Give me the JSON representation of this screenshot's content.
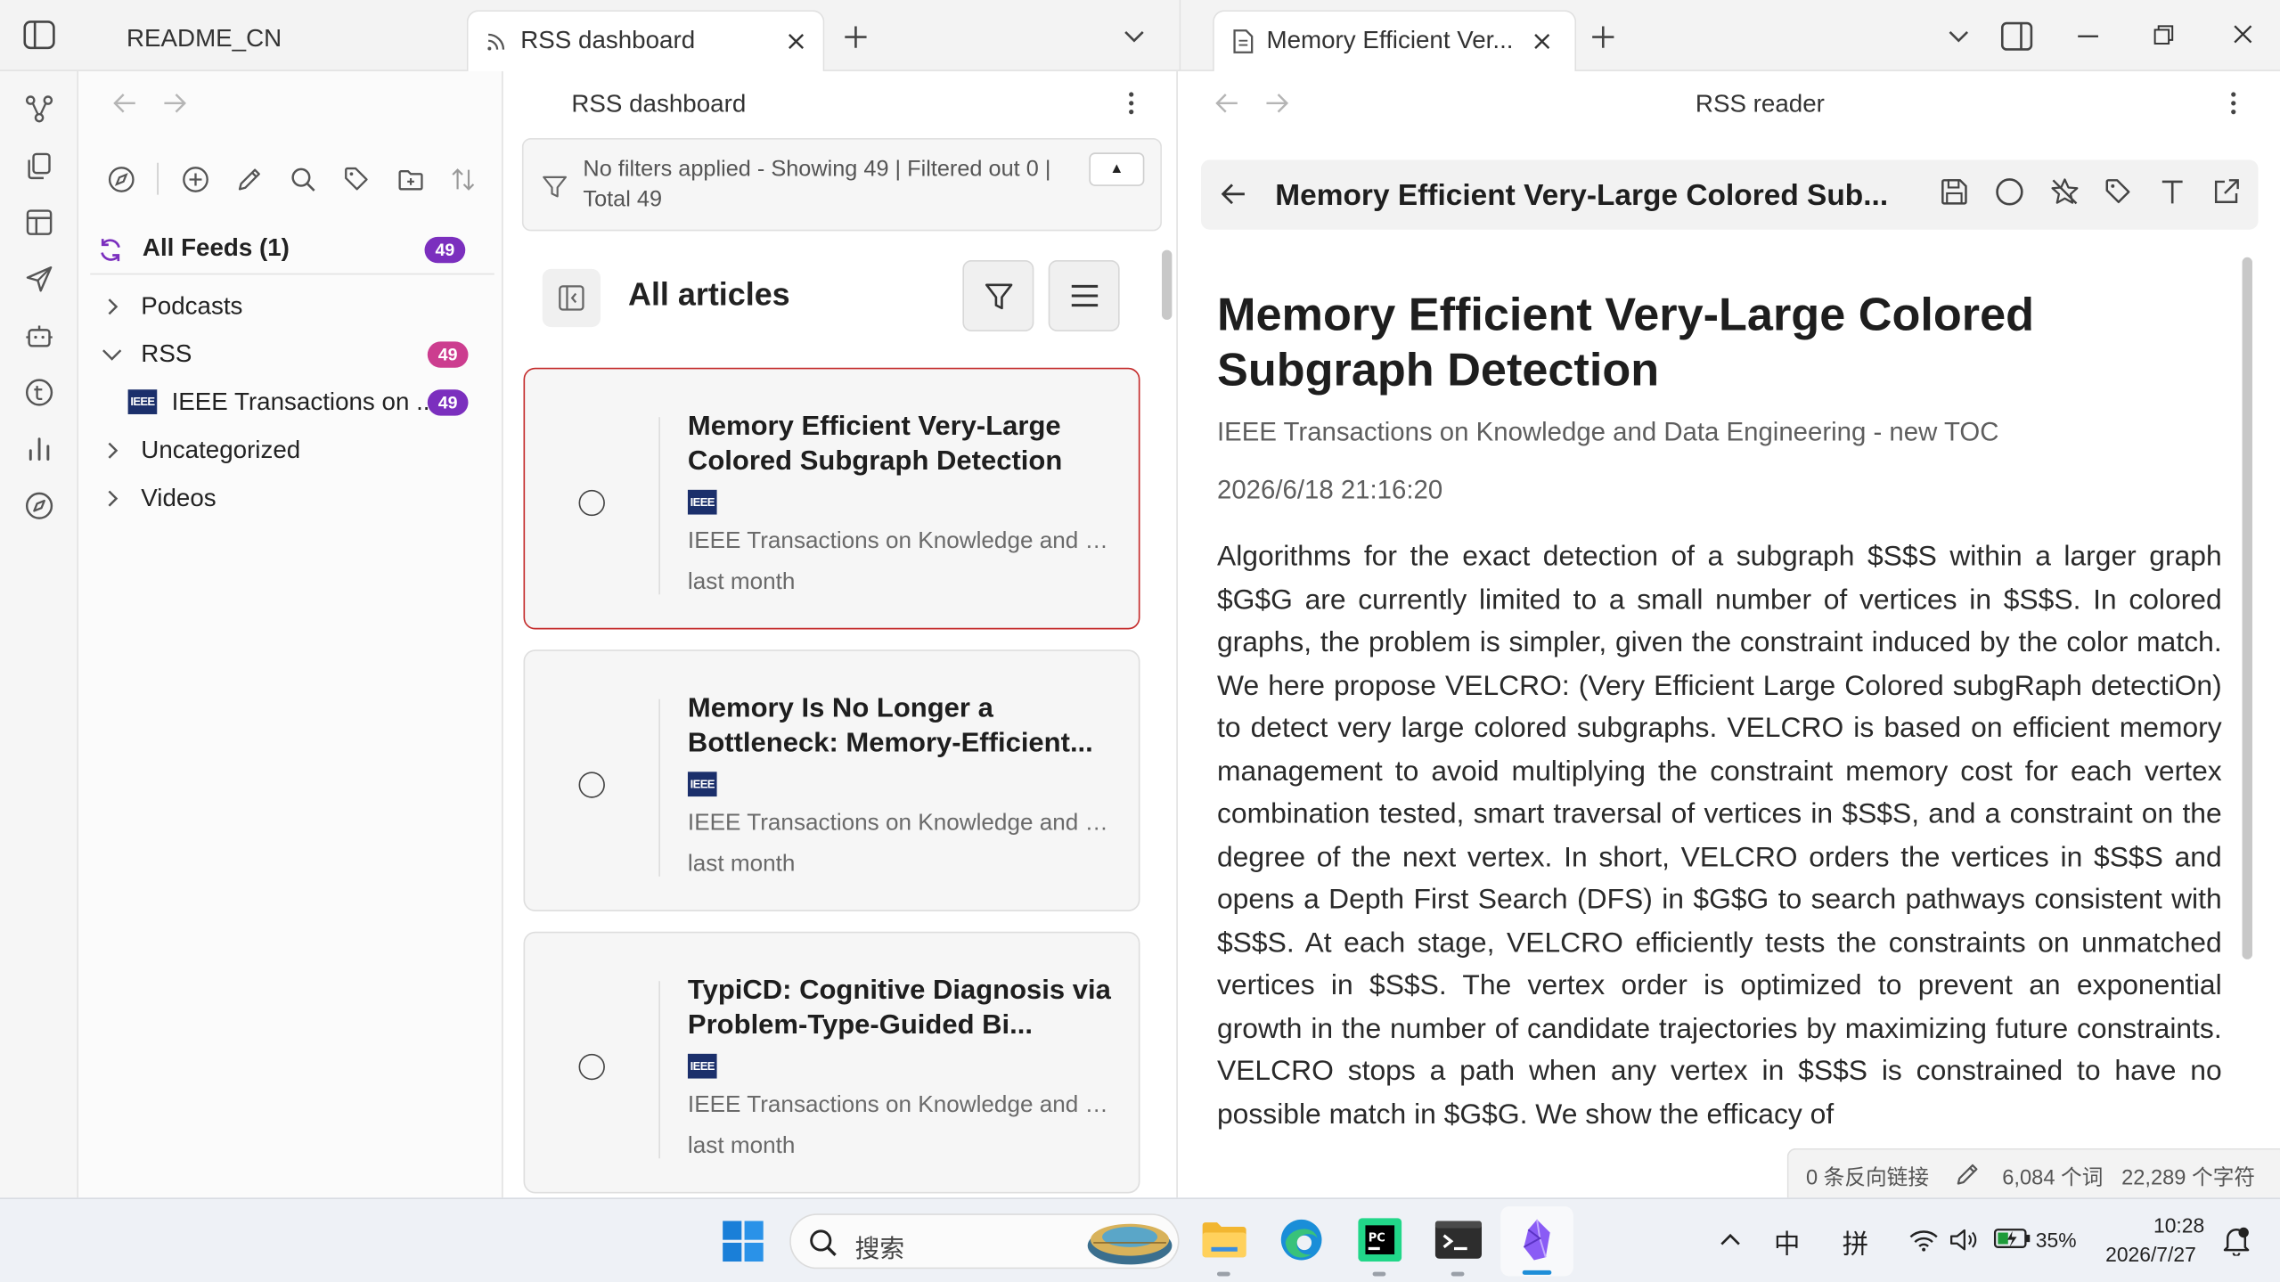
{
  "left_tabs": {
    "tabs": [
      {
        "label": "README_CN"
      },
      {
        "label": "RSS dashboard",
        "active": true
      }
    ]
  },
  "right_tabs": {
    "tabs": [
      {
        "label": "Memory Efficient Ver...",
        "active": true
      }
    ]
  },
  "dashboard": {
    "header_title": "RSS dashboard",
    "filter_status": "No filters applied - Showing 49 | Filtered out 0 | Total 49",
    "collapse_glyph": "▲",
    "list_title": "All articles"
  },
  "sidebar": {
    "all_feeds": {
      "label": "All Feeds (1)",
      "count": "49"
    },
    "folders": [
      {
        "label": "Podcasts",
        "expanded": false
      },
      {
        "label": "RSS",
        "expanded": true,
        "count": "49"
      },
      {
        "label": "Uncategorized",
        "expanded": false
      },
      {
        "label": "Videos",
        "expanded": false
      }
    ],
    "feed": {
      "logo": "IEEE",
      "label": "IEEE Transactions on ...",
      "count": "49"
    }
  },
  "articles": [
    {
      "title": "Memory Efficient Very-Large Colored Subgraph Detection",
      "source": "IEEE Transactions on Knowledge and Data Engineering - new TOC",
      "date": "last month",
      "logo": "IEEE",
      "selected": true
    },
    {
      "title": "Memory Is No Longer a Bottleneck: Memory-Efficient...",
      "source": "IEEE Transactions on Knowledge and Data Engineering - new TOC",
      "date": "last month",
      "logo": "IEEE",
      "selected": false
    },
    {
      "title": "TypiCD: Cognitive Diagnosis via Problem-Type-Guided Bi...",
      "source": "IEEE Transactions on Knowledge and Data Engineering - new TOC",
      "date": "last month",
      "logo": "IEEE",
      "selected": false
    }
  ],
  "reader": {
    "header_title": "RSS reader",
    "toolbar_title": "Memory Efficient Very-Large Colored Sub...",
    "title": "Memory Efficient Very-Large Colored Subgraph Detection",
    "feed": "IEEE Transactions on Knowledge and Data Engineering - new TOC",
    "date": "2026/6/18 21:16:20",
    "body": "Algorithms for the exact detection of a subgraph $S$S within a larger graph $G$G are currently limited to a small number of vertices in $S$S. In colored graphs, the problem is simpler, given the constraint induced by the color match. We here propose VELCRO: (Very Efficient Large Colored subgRaph detectiOn) to detect very large colored subgraphs. VELCRO is based on efficient memory management to avoid multiplying the constraint memory cost for each vertex combination tested, smart traversal of vertices in $S$S, and a constraint on the degree of the next vertex. In short, VELCRO orders the vertices in $S$S and opens a Depth First Search (DFS) in $G$G to search pathways consistent with $S$S. At each stage, VELCRO efficiently tests the constraints on unmatched vertices in $S$S. The vertex order is optimized to prevent an exponential growth in the number of candidate trajectories by maximizing future constraints. VELCRO stops a path when any vertex in $S$S is constrained to have no possible match in $G$G. We show the efficacy of"
  },
  "status_bar": {
    "backlinks": "0 条反向链接",
    "words": "6,084 个词",
    "chars": "22,289 个字符"
  },
  "taskbar": {
    "search_placeholder": "搜索",
    "ime_lang": "中",
    "ime_mode": "拼",
    "battery": "35%",
    "time": "10:28",
    "date": "2026/7/27"
  },
  "colors": {
    "accent_purple": "#7b2fbe",
    "badge_pink": "#cc3d8f",
    "selected_border": "#c42b2b",
    "ieee_blue": "#1b2f6b"
  }
}
